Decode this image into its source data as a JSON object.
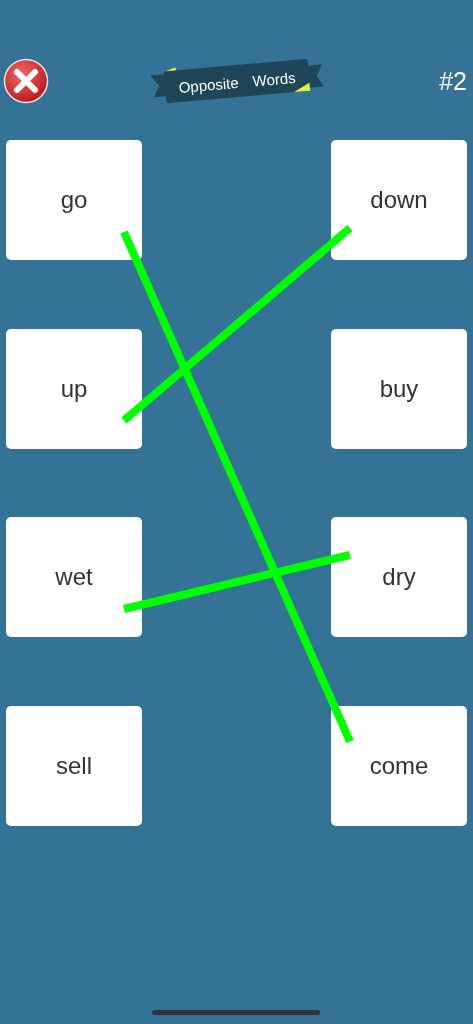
{
  "header": {
    "title": "Opposite Words",
    "level_number": "#2"
  },
  "left_words": [
    {
      "word": "go",
      "kind": "steep"
    },
    {
      "word": "up",
      "kind": "rising"
    },
    {
      "word": "wet",
      "kind": "flat"
    },
    {
      "word": "sell",
      "kind": "unlinked"
    }
  ],
  "right_words": [
    "down",
    "buy",
    "dry",
    "come"
  ]
}
